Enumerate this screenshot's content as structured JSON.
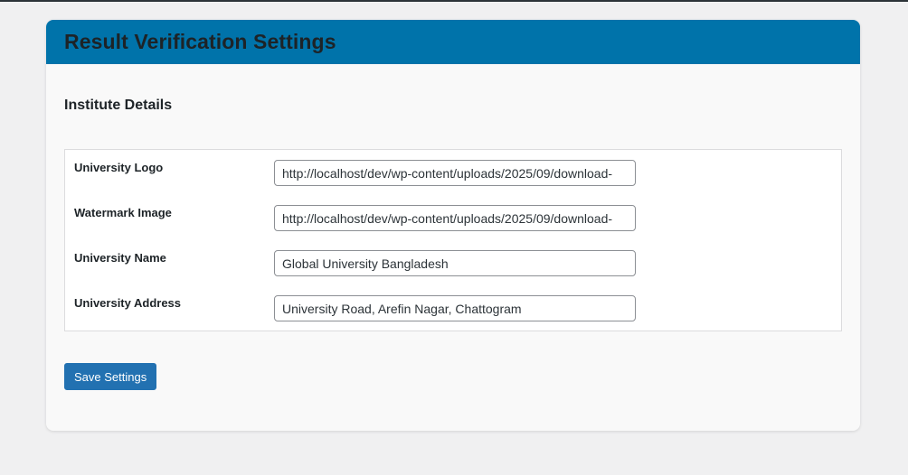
{
  "page": {
    "title": "Result Verification Settings"
  },
  "section": {
    "title": "Institute Details"
  },
  "fields": [
    {
      "label": "University Logo",
      "value": "http://localhost/dev/wp-content/uploads/2025/09/download-"
    },
    {
      "label": "Watermark Image",
      "value": "http://localhost/dev/wp-content/uploads/2025/09/download-"
    },
    {
      "label": "University Name",
      "value": "Global University Bangladesh"
    },
    {
      "label": "University Address",
      "value": "University Road, Arefin Nagar, Chattogram"
    }
  ],
  "actions": {
    "save_label": "Save Settings"
  },
  "colors": {
    "header_bg": "#0073aa",
    "button_bg": "#2271b1",
    "page_bg": "#f0f0f1",
    "panel_bg": "#f9f9f9"
  }
}
